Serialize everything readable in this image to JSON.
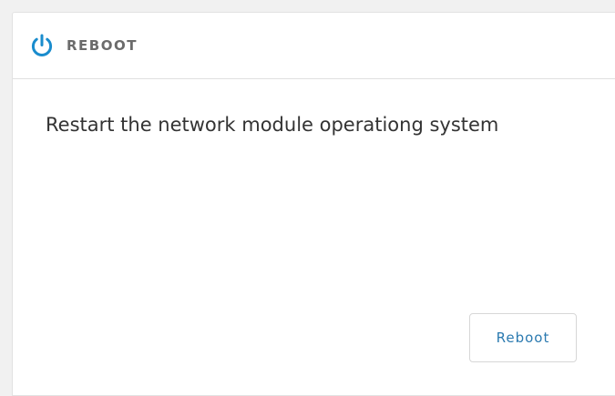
{
  "panel": {
    "icon": "power-icon",
    "title": "REBOOT",
    "description": "Restart the network module operationg system",
    "button_label": "Reboot"
  },
  "colors": {
    "accent": "#1a8ccd",
    "button_text": "#2b7ab0",
    "title_text": "#6b6b6b",
    "body_text": "#333333"
  }
}
